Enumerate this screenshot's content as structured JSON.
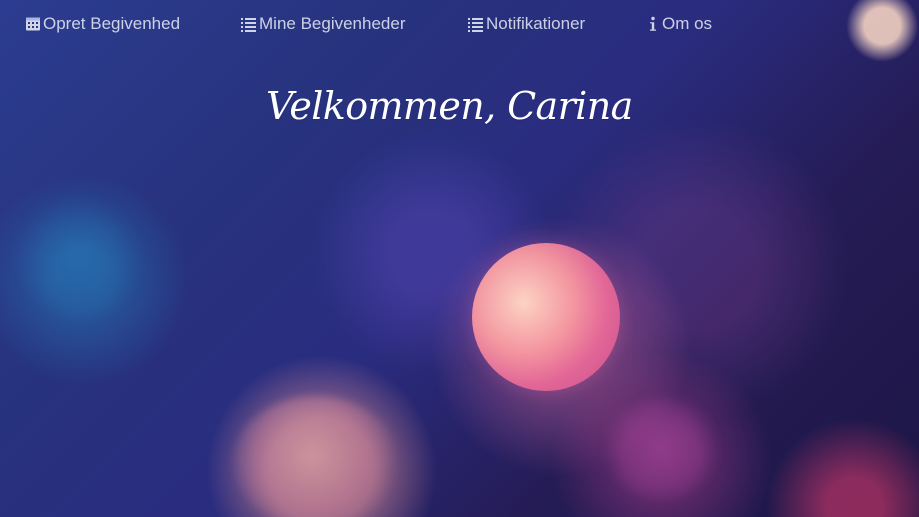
{
  "nav": {
    "items": [
      {
        "label": "Opret Begivenhed",
        "icon": "calendar-icon"
      },
      {
        "label": "Mine Begivenheder",
        "icon": "list-icon"
      },
      {
        "label": "Notifikationer",
        "icon": "list-icon"
      },
      {
        "label": "Om os",
        "icon": "info-icon"
      }
    ]
  },
  "welcome": {
    "title": "Velkommen, Carina"
  },
  "theme": {
    "nav_text": "#e7eaf5",
    "title_text": "#ffffff",
    "background_dark": "#1d1645",
    "background_blue": "#2c3c90",
    "bokeh_pink": "#ef6c9a"
  }
}
